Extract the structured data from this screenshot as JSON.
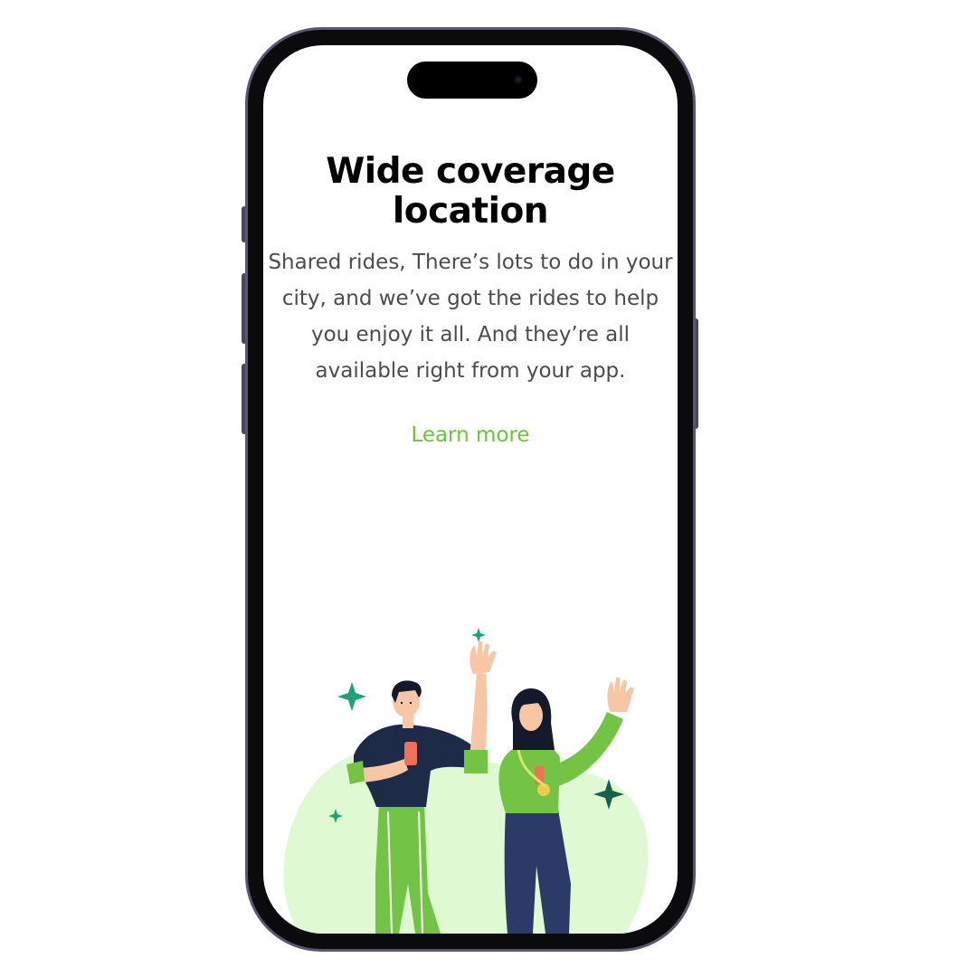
{
  "onboarding": {
    "title": "Wide coverage location",
    "description": "Shared rides, There’s lots to do in your city, and we’ve got the rides to help you enjoy it all. And they’re all available right from your app.",
    "learn_more_label": "Learn more"
  },
  "colors": {
    "accent": "#6cc23c",
    "title": "#000000",
    "body": "#4c4c4c",
    "blob": "#dff9d3",
    "sparkle": "#1ba377",
    "phone_frame": "#5d5670"
  },
  "illustration": {
    "icon": "people-waving-illustration"
  }
}
